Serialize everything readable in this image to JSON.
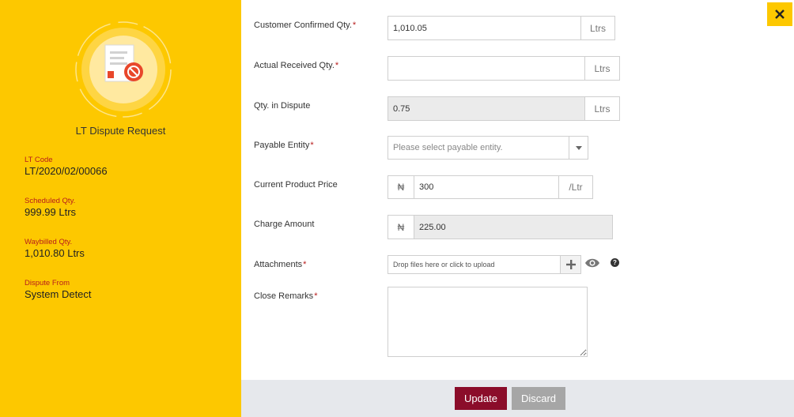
{
  "sidebar": {
    "title": "LT Dispute Request",
    "fields": [
      {
        "label": "LT Code",
        "value": "LT/2020/02/00066"
      },
      {
        "label": "Scheduled Qty.",
        "value": "999.99 Ltrs"
      },
      {
        "label": "Waybilled Qty.",
        "value": "1,010.80 Ltrs"
      },
      {
        "label": "Dispute From",
        "value": "System Detect"
      }
    ]
  },
  "form": {
    "customer_confirmed": {
      "label": "Customer Confirmed Qty.",
      "required": "*",
      "value": "1,010.05",
      "unit": "Ltrs"
    },
    "actual_received": {
      "label": "Actual Received Qty.",
      "required": "*",
      "value": "",
      "unit": "Ltrs"
    },
    "qty_dispute": {
      "label": "Qty. in Dispute",
      "value": "0.75",
      "unit": "Ltrs"
    },
    "payable_entity": {
      "label": "Payable Entity",
      "required": "*",
      "placeholder": "Please select payable entity."
    },
    "product_price": {
      "label": "Current Product Price",
      "currency": "₦",
      "value": "300",
      "unit": "/Ltr"
    },
    "charge_amount": {
      "label": "Charge Amount",
      "currency": "₦",
      "value": "225.00"
    },
    "attachments": {
      "label": "Attachments",
      "required": "*",
      "drop_text": "Drop files here or click to upload",
      "help": "?"
    },
    "close_remarks": {
      "label": "Close Remarks",
      "required": "*",
      "value": ""
    }
  },
  "footer": {
    "update_label": "Update",
    "discard_label": "Discard"
  },
  "colors": {
    "sidebar": "#fdc800",
    "update": "#8b0d2a",
    "discard": "#a6a6a6",
    "required": "#b71c1c"
  },
  "icons": {
    "emblem": "document-blocked-icon",
    "close": "close-icon",
    "add": "plus-icon",
    "preview": "eye-icon",
    "help": "question-icon",
    "dropdown": "chevron-down-icon"
  }
}
